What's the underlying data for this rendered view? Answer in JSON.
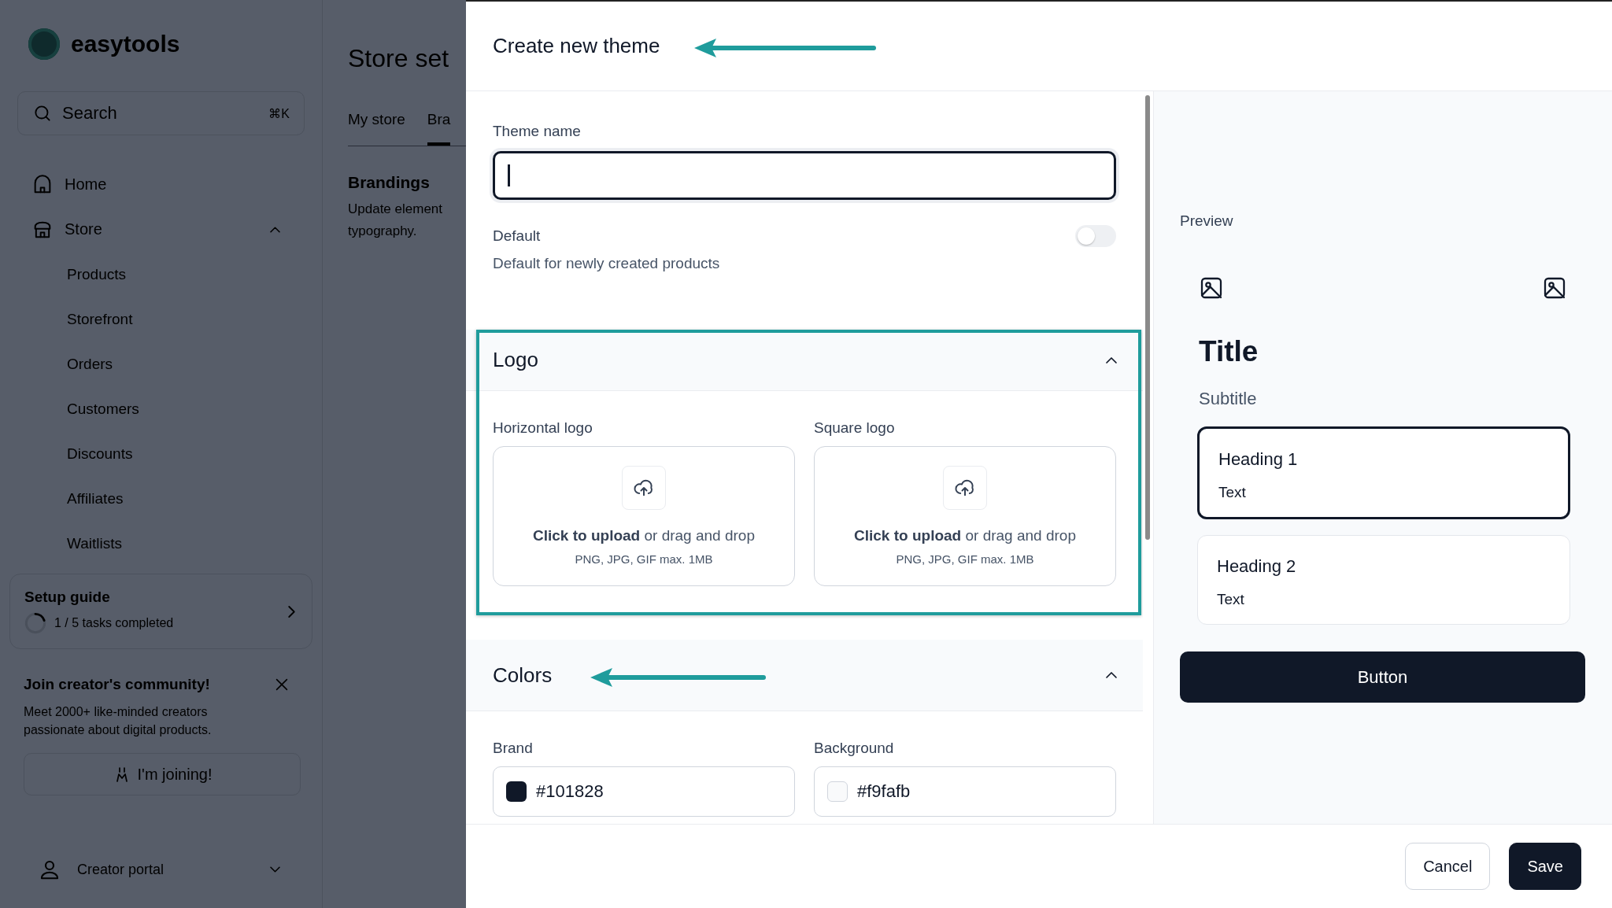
{
  "sidebar": {
    "brand": "easytools",
    "search": {
      "placeholder": "Search",
      "shortcut": "⌘K"
    },
    "nav": [
      {
        "label": "Home",
        "kind": "home",
        "expanded": false
      },
      {
        "label": "Store",
        "kind": "store",
        "expanded": true,
        "children": [
          {
            "label": "Products"
          },
          {
            "label": "Storefront"
          },
          {
            "label": "Orders"
          },
          {
            "label": "Customers"
          },
          {
            "label": "Discounts"
          },
          {
            "label": "Affiliates"
          },
          {
            "label": "Waitlists"
          }
        ]
      }
    ],
    "setup_guide": {
      "title": "Setup guide",
      "progress": "1 / 5 tasks completed",
      "level": 0.2
    },
    "community": {
      "title": "Join creator's community!",
      "text": "Meet 2000+ like-minded creators passionate about digital products.",
      "button": "I'm joining!"
    },
    "account": {
      "label": "Creator portal"
    }
  },
  "background_page": {
    "title": "Store set",
    "tabs": [
      {
        "label": "My store",
        "selected": false
      },
      {
        "label": "Bra",
        "selected": true
      }
    ],
    "section_title": "Brandings",
    "section_text": [
      "Update element",
      "typography."
    ]
  },
  "drawer": {
    "title": "Create new theme",
    "title_arrow": true,
    "theme_name": {
      "label": "Theme name",
      "focused": true
    },
    "default": {
      "label": "Default",
      "description": "Default for newly created products",
      "on": false
    },
    "sections": [
      {
        "title": "Logo",
        "kind": "uploads",
        "expanded": true,
        "highlighted": true,
        "arrow": false,
        "fields": [
          {
            "label": "Horizontal logo",
            "action": "**Click to upload** or drag and drop",
            "hint": "PNG, JPG, GIF max. 1MB"
          },
          {
            "label": "Square logo",
            "action": "**Click to upload** or drag and drop",
            "hint": "PNG, JPG, GIF max. 1MB"
          }
        ]
      },
      {
        "title": "Colors",
        "kind": "colors",
        "expanded": true,
        "highlighted": false,
        "arrow": true,
        "fields": [
          {
            "label": "Brand",
            "value": "#101828",
            "color": "#101828"
          },
          {
            "label": "Background",
            "value": "#f9fafb",
            "color": "#f9fafb"
          }
        ]
      }
    ],
    "preview": {
      "label": "Preview",
      "title": "Title",
      "subtitle": "Subtitle",
      "cards": [
        {
          "heading": "Heading 1",
          "text": "Text",
          "selected": true
        },
        {
          "heading": "Heading 2",
          "text": "Text",
          "selected": false
        }
      ],
      "button": "Button"
    },
    "footer": {
      "buttons": [
        {
          "label": "Cancel",
          "kind": "secondary"
        },
        {
          "label": "Save",
          "kind": "primary"
        }
      ]
    }
  }
}
